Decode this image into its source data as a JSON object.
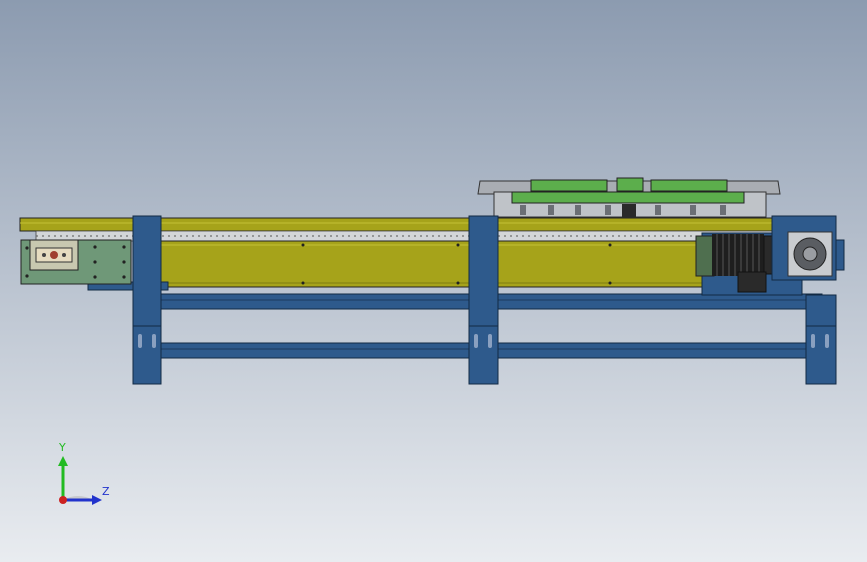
{
  "view": {
    "background_top": "#8c9bb0",
    "background_bottom": "#e8ebef",
    "model": "conveyor-assembly"
  },
  "triad": {
    "y_label": "Y",
    "z_label": "Z",
    "y_color": "#22bb22",
    "z_color": "#2233cc",
    "x_color": "#cc2222"
  },
  "colors": {
    "frame_blue": "#2e5a8c",
    "frame_blue_dark": "#1c3a5e",
    "rail_yellow": "#a6a31a",
    "rail_yellow_light": "#c4c236",
    "motor_black": "#1e1e1e",
    "plate_green": "#6f9878",
    "fixture_green": "#5cae4c",
    "fixture_grey": "#a9adb3"
  }
}
